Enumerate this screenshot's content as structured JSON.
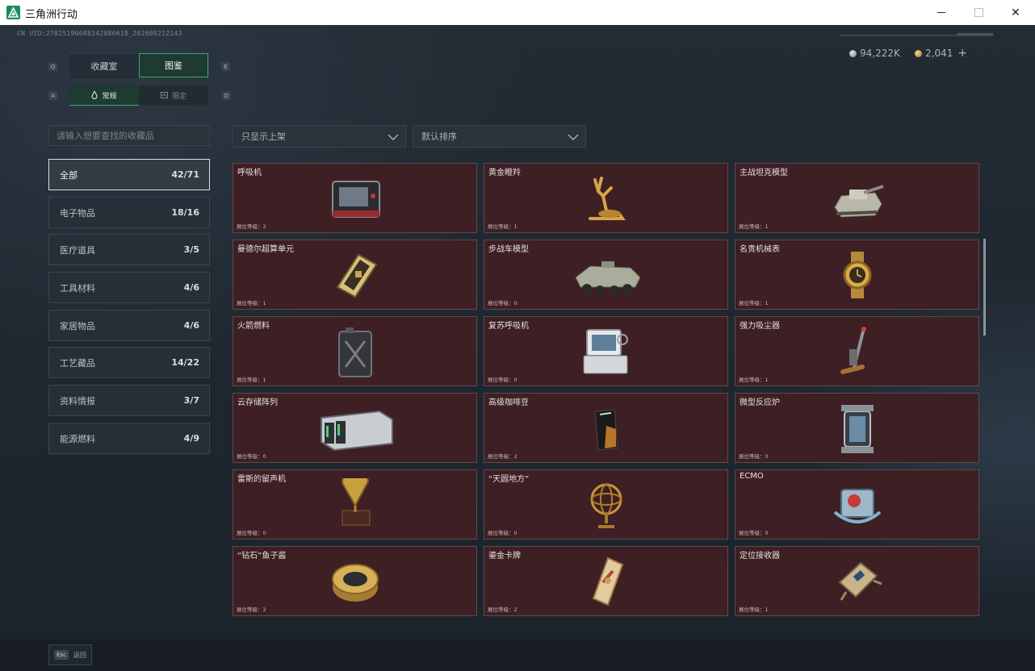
{
  "window": {
    "title": "三角洲行动",
    "minimize": "–",
    "maximize": "☐",
    "close": "✕"
  },
  "uid": "CN UID:27025196088342886618_202608212143",
  "currency": {
    "silver": "94,222K",
    "gold": "2,041",
    "plus": "+"
  },
  "hints": {
    "q": "Q",
    "e": "E",
    "a": "A",
    "d": "D"
  },
  "tabs": [
    {
      "label": "收藏室"
    },
    {
      "label": "图鉴"
    }
  ],
  "subtabs": [
    {
      "label": "常规",
      "icon": "flame-icon"
    },
    {
      "label": "限定",
      "icon": "card-icon"
    }
  ],
  "search": {
    "placeholder": "请输入想要查找的收藏品"
  },
  "filters": {
    "shelf": "只显示上架",
    "sort": "默认排序"
  },
  "categories": [
    {
      "label": "全部",
      "count": "42/71",
      "active": true
    },
    {
      "label": "电子物品",
      "count": "18/16"
    },
    {
      "label": "医疗道具",
      "count": "3/5"
    },
    {
      "label": "工具材料",
      "count": "4/6"
    },
    {
      "label": "家居物品",
      "count": "4/6"
    },
    {
      "label": "工艺藏品",
      "count": "14/22"
    },
    {
      "label": "资料情报",
      "count": "3/7"
    },
    {
      "label": "能源燃料",
      "count": "4/9"
    }
  ],
  "items": [
    {
      "name": "呼吸机",
      "level": "展位等级：2",
      "icon": "ventilator-icon"
    },
    {
      "name": "黄金瞪羚",
      "level": "展位等级：1",
      "icon": "golden-gazelle-icon"
    },
    {
      "name": "主战坦克模型",
      "level": "展位等级：1",
      "icon": "tank-model-icon"
    },
    {
      "name": "曼德尔超算单元",
      "level": "展位等级：1",
      "icon": "supercomputer-unit-icon"
    },
    {
      "name": "步战车模型",
      "level": "展位等级：0",
      "icon": "ifv-model-icon"
    },
    {
      "name": "名贵机械表",
      "level": "展位等级：1",
      "icon": "watch-icon"
    },
    {
      "name": "火箭燃料",
      "level": "展位等级：1",
      "icon": "rocket-fuel-icon"
    },
    {
      "name": "复苏呼吸机",
      "level": "展位等级：0",
      "icon": "resuscitator-icon"
    },
    {
      "name": "强力吸尘器",
      "level": "展位等级：1",
      "icon": "vacuum-icon"
    },
    {
      "name": "云存储阵列",
      "level": "展位等级：0",
      "icon": "storage-array-icon"
    },
    {
      "name": "高级咖啡豆",
      "level": "展位等级：2",
      "icon": "coffee-bag-icon"
    },
    {
      "name": "微型反应炉",
      "level": "展位等级：0",
      "icon": "reactor-icon"
    },
    {
      "name": "雷斯的留声机",
      "level": "展位等级：0",
      "icon": "gramophone-icon"
    },
    {
      "name": "“天圆地方”",
      "level": "展位等级：0",
      "icon": "armillary-icon"
    },
    {
      "name": "ECMO",
      "level": "展位等级：0",
      "icon": "ecmo-icon"
    },
    {
      "name": "“钻石”鱼子酱",
      "level": "展位等级：2",
      "icon": "caviar-tin-icon"
    },
    {
      "name": "鎏金卡牌",
      "level": "展位等级：2",
      "icon": "gold-card-icon"
    },
    {
      "name": "定位接收器",
      "level": "展位等级：1",
      "icon": "gps-receiver-icon"
    }
  ],
  "footer": {
    "key": "Esc",
    "label": "返回"
  },
  "colors": {
    "accent": "#3aa872",
    "card_bg": "#3e1f24",
    "card_border": "#5d4a4e"
  }
}
